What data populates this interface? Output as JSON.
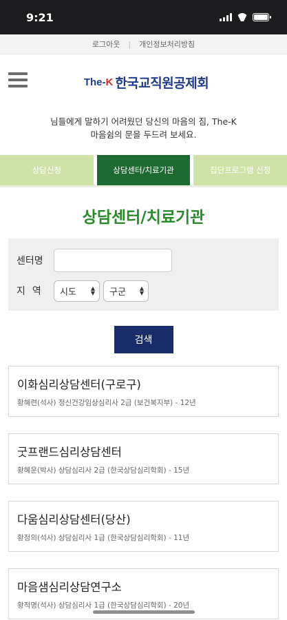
{
  "status_bar": {
    "time": "9:21"
  },
  "top_links": {
    "logout": "로그아웃",
    "separator": "|",
    "privacy": "개인정보처리방침"
  },
  "header": {
    "logo_prefix": "The-",
    "logo_k": "K",
    "logo_name": "한국교직원공제회"
  },
  "intro": {
    "line1": "님들에게 말하기 어려웠던 당신의 마음의 짐, The-K",
    "line2": "마음쉼의 문을 두드려 보세요."
  },
  "tabs": [
    {
      "label": "상담신청"
    },
    {
      "label": "상담센터/치료기관"
    },
    {
      "label": "집단프로그램 신청"
    }
  ],
  "page_title": "상담센터/치료기관",
  "search": {
    "center_label": "센터명",
    "center_value": "",
    "region_label": "지역",
    "sido": "시도",
    "gugun": "구군",
    "button": "검색"
  },
  "results": [
    {
      "name": "이화심리상담센터(구로구)",
      "meta": "황혜련(석사) 정신건강임상심리사 2급 (보건복지부) - 12년"
    },
    {
      "name": "굿프랜드심리상담센터",
      "meta": "황혜운(박사) 상담심리사 2급 (한국상담심리학회) - 15년"
    },
    {
      "name": "다움심리상담센터(당산)",
      "meta": "황정의(석사) 상담심리사 1급 (한국상담심리학회) - 11년"
    },
    {
      "name": "마음샘심리상담연구소",
      "meta": "황적명(석사) 상담심리사 1급 (한국상담심리학회) - 20년"
    }
  ],
  "colors": {
    "accent_green": "#1d6a32",
    "light_green": "#cfe3a9",
    "title_green": "#2a8a2a",
    "button_navy": "#1a2d6b",
    "logo_blue": "#1e3c8c"
  }
}
